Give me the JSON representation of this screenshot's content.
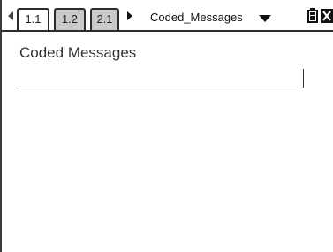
{
  "tabs": [
    {
      "label": "1.1",
      "active": true
    },
    {
      "label": "1.2",
      "active": false
    },
    {
      "label": "2.1",
      "active": false
    }
  ],
  "document": {
    "title": "Coded_Messages"
  },
  "icons": {
    "prev": "triangle-left-icon",
    "next": "triangle-right-icon",
    "menu": "triangle-down-icon",
    "battery": "battery-icon",
    "close": "close-icon"
  },
  "page": {
    "heading": "Coded Messages",
    "answer_value": ""
  },
  "colors": {
    "inactive_tab": "#c9c9c9",
    "frame": "#2c2c2c",
    "background": "#ffffff"
  }
}
